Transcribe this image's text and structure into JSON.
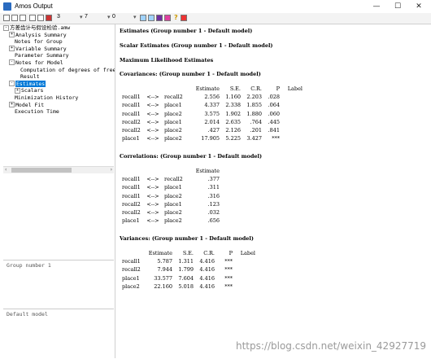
{
  "window": {
    "title": "Amos Output",
    "minimize": "—",
    "maximize": "☐",
    "close": "✕"
  },
  "toolbar": {
    "decimals": "3",
    "width": "7",
    "column": "0"
  },
  "tree": {
    "items": [
      {
        "label": "方差齿计与假设检验.amw",
        "indent": 0,
        "expand": "-",
        "selected": false
      },
      {
        "label": "Analysis Summary",
        "indent": 1,
        "expand": "+",
        "selected": false
      },
      {
        "label": "Notes for Group",
        "indent": 1,
        "expand": "",
        "selected": false
      },
      {
        "label": "Variable Summary",
        "indent": 1,
        "expand": "+",
        "selected": false
      },
      {
        "label": "Parameter Summary",
        "indent": 1,
        "expand": "",
        "selected": false
      },
      {
        "label": "Notes for Model",
        "indent": 1,
        "expand": "-",
        "selected": false
      },
      {
        "label": "Computation of degrees of free",
        "indent": 2,
        "expand": "",
        "selected": false
      },
      {
        "label": "Result",
        "indent": 2,
        "expand": "",
        "selected": false
      },
      {
        "label": "Estimates",
        "indent": 1,
        "expand": "-",
        "selected": true
      },
      {
        "label": "Scalars",
        "indent": 2,
        "expand": "+",
        "selected": false
      },
      {
        "label": "Minimization History",
        "indent": 1,
        "expand": "",
        "selected": false
      },
      {
        "label": "Model Fit",
        "indent": 1,
        "expand": "+",
        "selected": false
      },
      {
        "label": "Execution Time",
        "indent": 1,
        "expand": "",
        "selected": false
      }
    ],
    "group": "Group number 1",
    "model": "Default model"
  },
  "content": {
    "heading": "Estimates (Group number 1 - Default model)",
    "scalar_heading": "Scalar Estimates (Group number 1 - Default model)",
    "ml_heading": "Maximum Likelihood Estimates",
    "covariances": {
      "title": "Covariances: (Group number 1 - Default model)",
      "headers": [
        "",
        "",
        "",
        "Estimate",
        "S.E.",
        "C.R.",
        "P",
        "Label"
      ],
      "rows": [
        [
          "recall1",
          "<-->",
          "recall2",
          "2.556",
          "1.160",
          "2.203",
          ".028",
          ""
        ],
        [
          "recall1",
          "<-->",
          "place1",
          "4.337",
          "2.338",
          "1.855",
          ".064",
          ""
        ],
        [
          "recall1",
          "<-->",
          "place2",
          "3.575",
          "1.902",
          "1.880",
          ".060",
          ""
        ],
        [
          "recall2",
          "<-->",
          "place1",
          "2.014",
          "2.635",
          ".764",
          ".445",
          ""
        ],
        [
          "recall2",
          "<-->",
          "place2",
          ".427",
          "2.126",
          ".201",
          ".841",
          ""
        ],
        [
          "place1",
          "<-->",
          "place2",
          "17.905",
          "5.225",
          "3.427",
          "***",
          ""
        ]
      ]
    },
    "correlations": {
      "title": "Correlations: (Group number 1 - Default model)",
      "headers": [
        "",
        "",
        "",
        "Estimate"
      ],
      "rows": [
        [
          "recall1",
          "<-->",
          "recall2",
          ".377"
        ],
        [
          "recall1",
          "<-->",
          "place1",
          ".311"
        ],
        [
          "recall1",
          "<-->",
          "place2",
          ".316"
        ],
        [
          "recall2",
          "<-->",
          "place1",
          ".123"
        ],
        [
          "recall2",
          "<-->",
          "place2",
          ".032"
        ],
        [
          "place1",
          "<-->",
          "place2",
          ".656"
        ]
      ]
    },
    "variances": {
      "title": "Variances: (Group number 1 - Default model)",
      "headers": [
        "",
        "Estimate",
        "S.E.",
        "C.R.",
        "P",
        "Label"
      ],
      "rows": [
        [
          "recall1",
          "5.787",
          "1.311",
          "4.416",
          "***",
          ""
        ],
        [
          "recall2",
          "7.944",
          "1.799",
          "4.416",
          "***",
          ""
        ],
        [
          "place1",
          "33.577",
          "7.604",
          "4.416",
          "***",
          ""
        ],
        [
          "place2",
          "22.160",
          "5.018",
          "4.416",
          "***",
          ""
        ]
      ]
    }
  },
  "watermark": "https://blog.csdn.net/weixin_42927719"
}
